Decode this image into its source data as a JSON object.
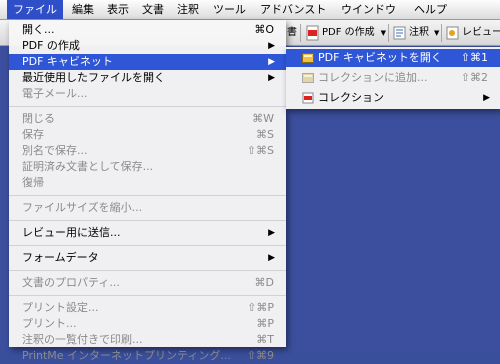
{
  "menubar": {
    "items": [
      "ファイル",
      "編集",
      "表示",
      "文書",
      "注釈",
      "ツール",
      "アドバンスト",
      "ウインドウ",
      "ヘルプ"
    ]
  },
  "toolbar": {
    "truncated_label": "書",
    "pdf_create": "PDF の作成",
    "annot": "注釈",
    "review": "レビュー"
  },
  "file_menu": {
    "items": [
      {
        "label": "開く...",
        "shortcut": "⌘O"
      },
      {
        "label": "PDF の作成",
        "arrow": "▶"
      },
      {
        "label": "PDF キャビネット",
        "arrow": "▶"
      },
      {
        "label": "最近使用したファイルを開く",
        "arrow": "▶"
      },
      {
        "label": "電子メール..."
      },
      {
        "label": "閉じる",
        "shortcut": "⌘W"
      },
      {
        "label": "保存",
        "shortcut": "⌘S"
      },
      {
        "label": "別名で保存...",
        "shortcut": "⇧⌘S"
      },
      {
        "label": "証明済み文書として保存..."
      },
      {
        "label": "復帰"
      },
      {
        "label": "ファイルサイズを縮小..."
      },
      {
        "label": "レビュー用に送信...",
        "arrow": "▶"
      },
      {
        "label": "フォームデータ",
        "arrow": "▶"
      },
      {
        "label": "文書のプロパティ...",
        "shortcut": "⌘D"
      },
      {
        "label": "プリント設定...",
        "shortcut": "⇧⌘P"
      },
      {
        "label": "プリント...",
        "shortcut": "⌘P"
      },
      {
        "label": "注釈の一覧付きで印刷...",
        "shortcut": "⌘T"
      },
      {
        "label": "PrintMe インターネットプリンティング...",
        "shortcut": "⇧⌘9"
      }
    ]
  },
  "cabinet_submenu": {
    "items": [
      {
        "label": "PDF キャビネットを開く",
        "shortcut": "⇧⌘1"
      },
      {
        "label": "コレクションに追加...",
        "shortcut": "⇧⌘2"
      },
      {
        "label": "コレクション",
        "arrow": "▶"
      }
    ]
  },
  "colors": {
    "highlight": "#2e56d6",
    "disabled_text": "#8a8a8a",
    "desktop": "#3b4f9e"
  }
}
